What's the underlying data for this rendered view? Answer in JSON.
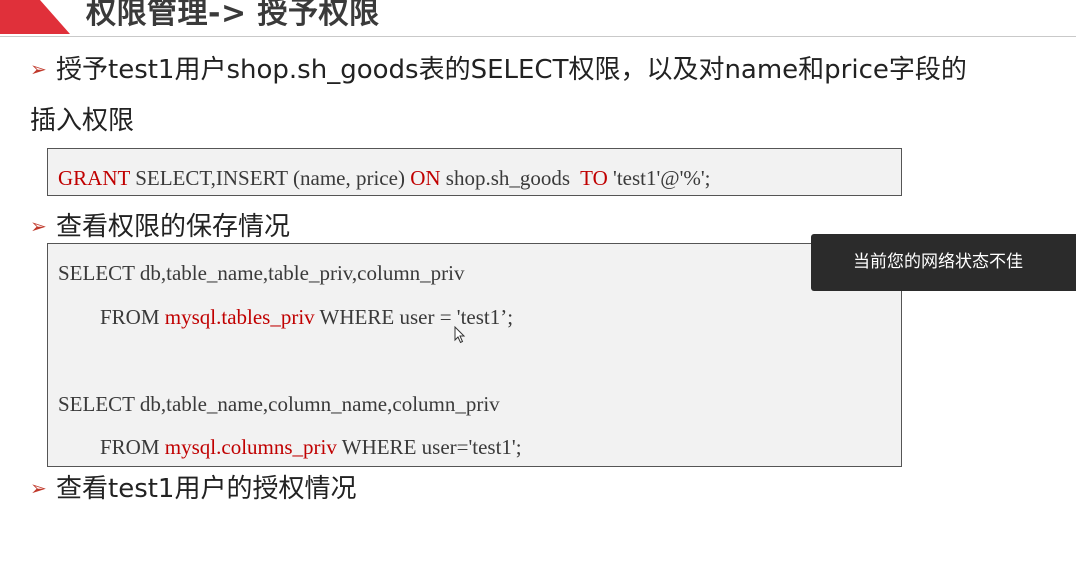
{
  "slide": {
    "title": "权限管理-> 授予权限",
    "bullet_arrow": "➢",
    "bullet1_line1": "授予test1用户shop.sh_goods表的SELECT权限，以及对name和price字段的",
    "bullet1_line2": "插入权限",
    "bullet2": "查看权限的保存情况",
    "bullet3": "查看test1用户的授权情况",
    "accent_color": "#e0303a",
    "keyword_color": "#c00000"
  },
  "code1": {
    "kw_grant": "GRANT",
    "part_select": " SELECT,INSERT (name, price) ",
    "kw_on": "ON",
    "part_table": " shop.sh_goods  ",
    "kw_to": "TO",
    "part_user": " 'test1'@'%';"
  },
  "code2": {
    "line1": "SELECT db,table_name,table_priv,column_priv",
    "line2_pre": "FROM ",
    "line2_kw": "mysql.tables_priv",
    "line2_post": " WHERE user = 'test1’;",
    "line3": "SELECT db,table_name,column_name,column_priv",
    "line4_pre": "FROM ",
    "line4_kw": "mysql.columns_priv",
    "line4_post": " WHERE user='test1';"
  },
  "toast": {
    "message": "当前您的网络状态不佳"
  }
}
